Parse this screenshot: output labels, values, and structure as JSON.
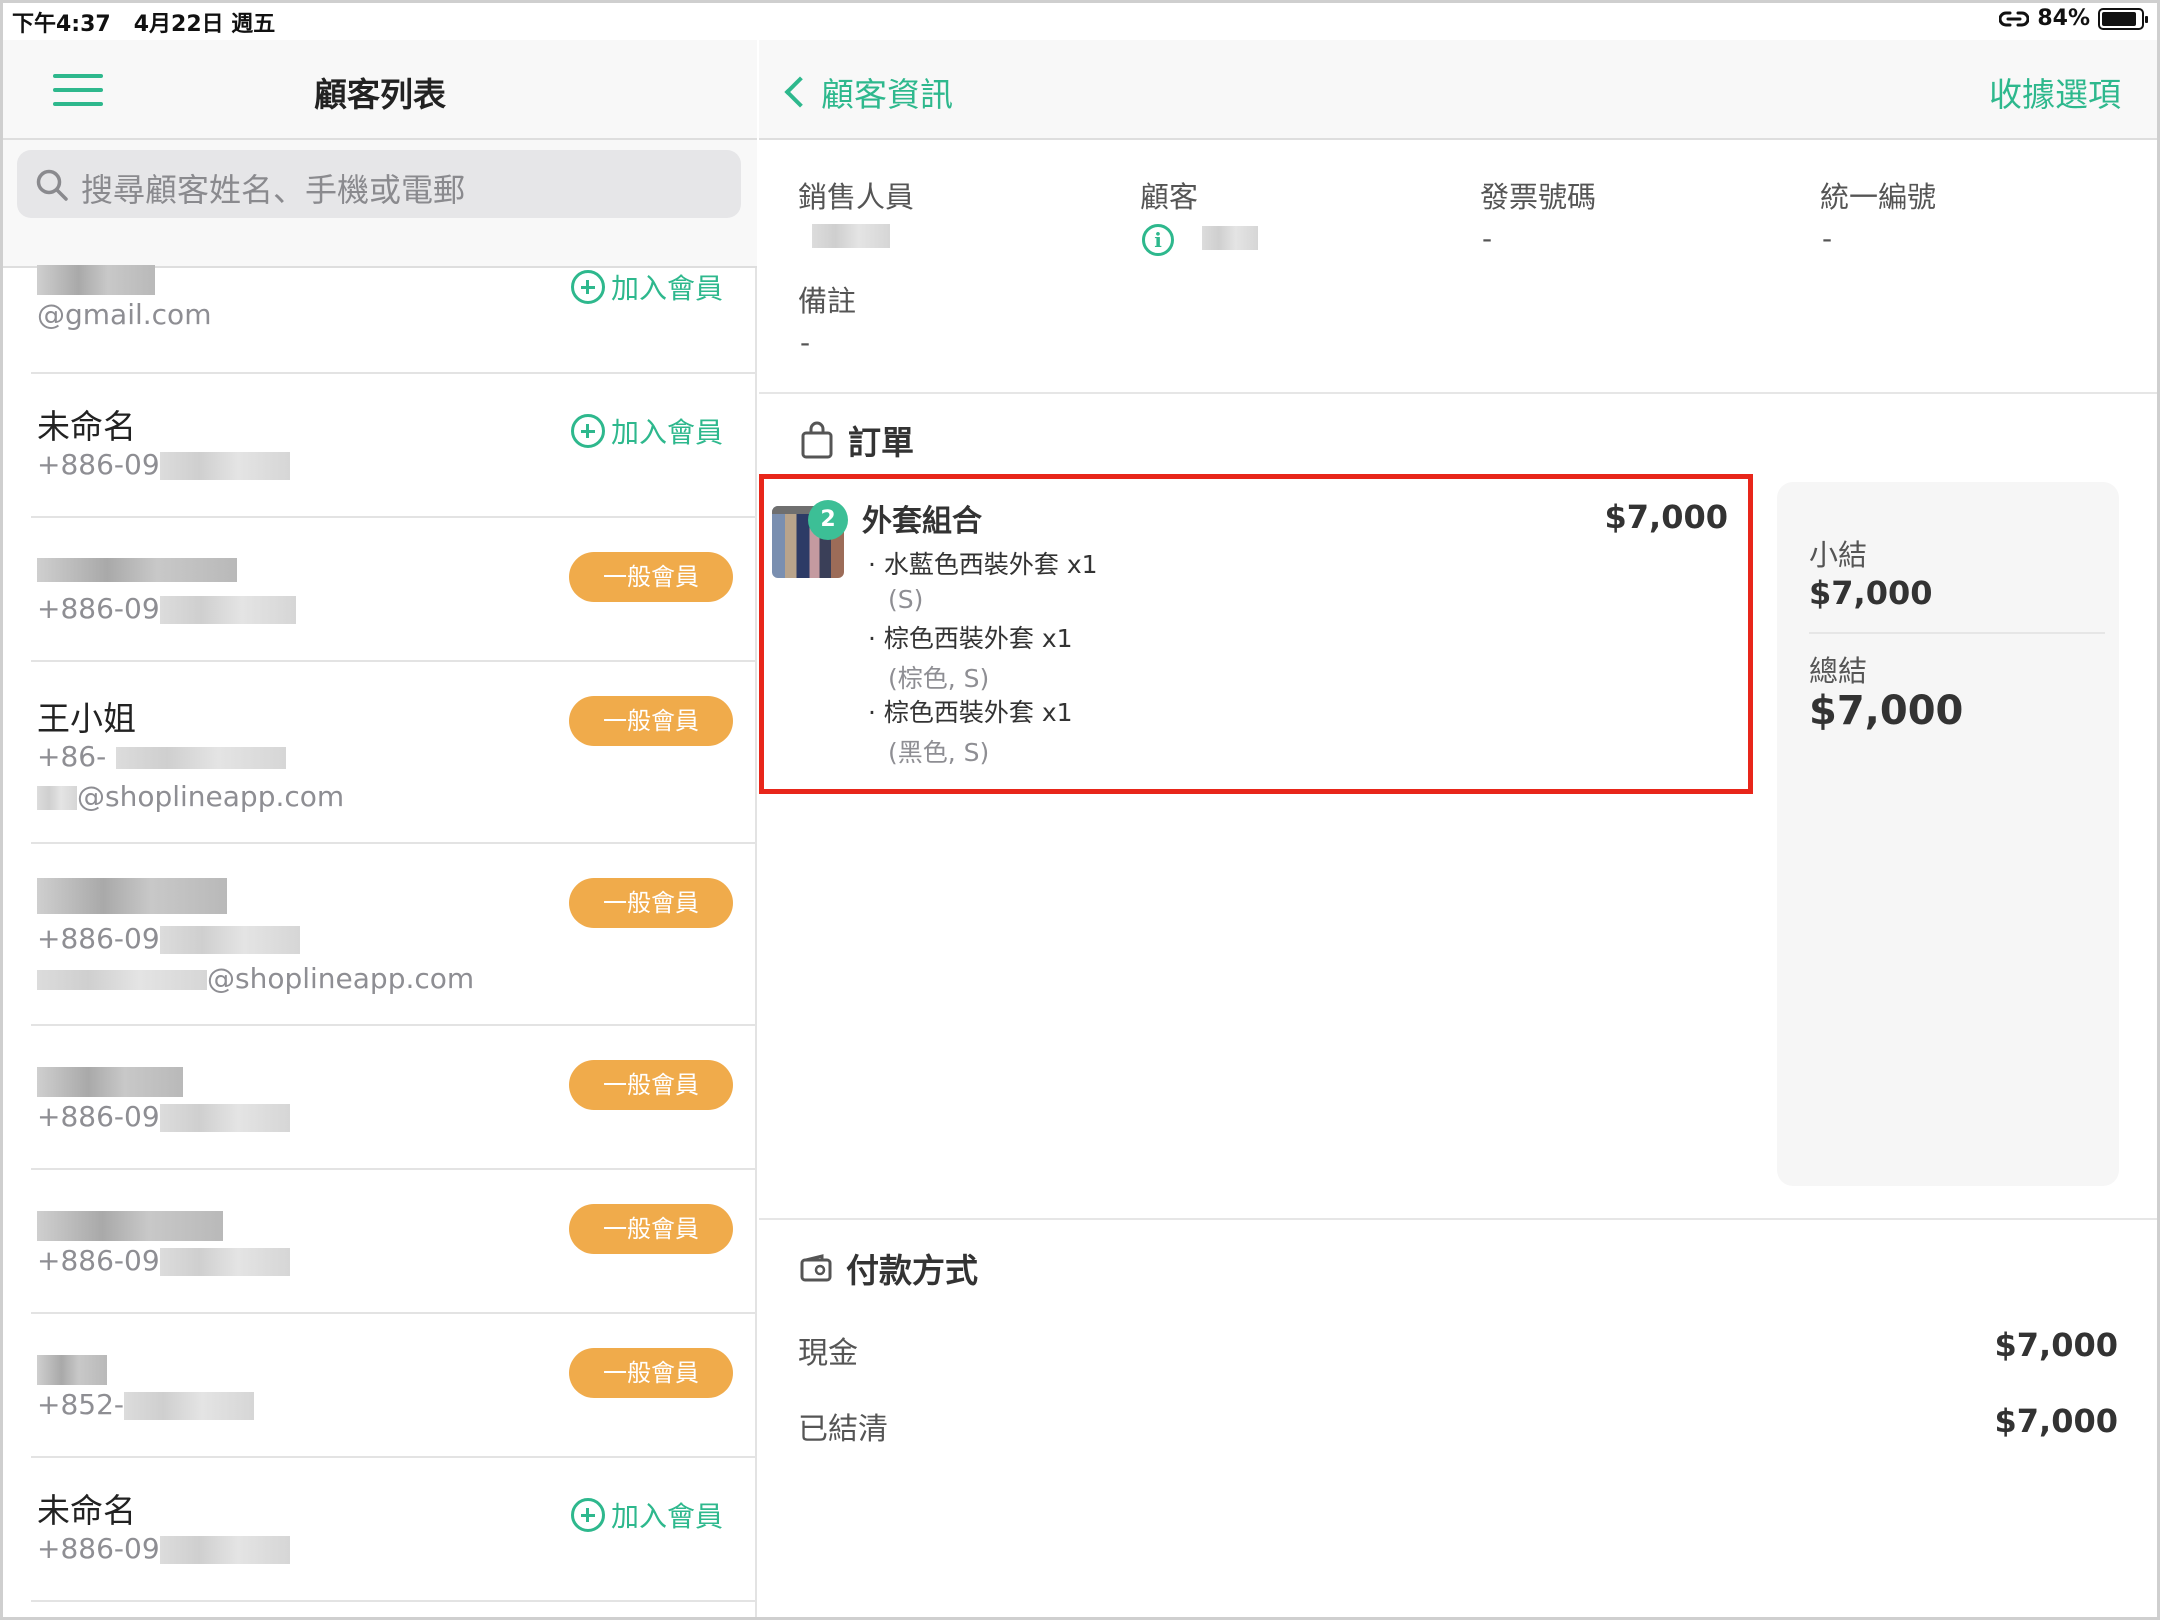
{
  "status_bar": {
    "time": "下午4:37",
    "date": "4月22日 週五",
    "battery": "84%"
  },
  "customer_list": {
    "title": "顧客列表",
    "search_placeholder": "搜尋顧客姓名、手機或電郵",
    "rows": [
      {
        "name": "",
        "sub1": "@gmail.com",
        "sub2": "",
        "action": "加入會員"
      },
      {
        "name": "未命名",
        "sub1": "+886-09",
        "sub2": "",
        "action": "加入會員"
      },
      {
        "name": "",
        "sub1": "+886-09",
        "sub2": "",
        "action": "一般會員"
      },
      {
        "name": "王小姐",
        "sub1": "+86-",
        "sub2": "@shoplineapp.com",
        "action": "一般會員"
      },
      {
        "name": "",
        "sub1": "+886-09",
        "sub2": "@shoplineapp.com",
        "action": "一般會員"
      },
      {
        "name": "",
        "sub1": "+886-09",
        "sub2": "",
        "action": "一般會員"
      },
      {
        "name": "",
        "sub1": "+886-09",
        "sub2": "",
        "action": "一般會員"
      },
      {
        "name": "",
        "sub1": "+852-",
        "sub2": "",
        "action": "一般會員"
      },
      {
        "name": "未命名",
        "sub1": "+886-09",
        "sub2": "",
        "action": "加入會員"
      }
    ]
  },
  "detail": {
    "back_label": "顧客資訊",
    "receipt_label": "收據選項",
    "fields": {
      "salesperson_label": "銷售人員",
      "customer_label": "顧客",
      "invoice_label": "發票號碼",
      "invoice_value": "-",
      "tax_id_label": "統一編號",
      "tax_id_value": "-",
      "note_label": "備註",
      "note_value": "-"
    },
    "order": {
      "title": "訂單",
      "bundle_name": "外套組合",
      "bundle_qty": "2",
      "bundle_price": "$7,000",
      "items": [
        {
          "label": "· 水藍色西裝外套 x1",
          "variant": "(S)"
        },
        {
          "label": "· 棕色西裝外套 x1",
          "variant": "(棕色, S)"
        },
        {
          "label": "· 棕色西裝外套 x1",
          "variant": "(黑色, S)"
        }
      ]
    },
    "summary": {
      "subtotal_label": "小結",
      "subtotal_value": "$7,000",
      "total_label": "總結",
      "total_value": "$7,000"
    },
    "payment": {
      "title": "付款方式",
      "method_label": "現金",
      "method_value": "$7,000",
      "paid_label": "已結清",
      "paid_value": "$7,000"
    }
  },
  "colors": {
    "accent": "#2eb88d",
    "member_badge": "#f0ab4b",
    "highlight": "#e8261a"
  }
}
